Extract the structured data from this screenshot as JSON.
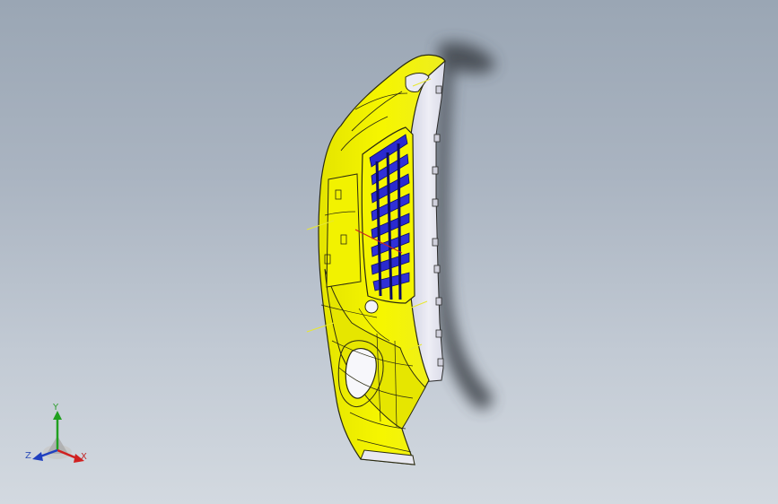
{
  "viewport": {
    "background_top": "#9aa6b4",
    "background_bottom": "#d3d9e0"
  },
  "model": {
    "part": "bumper-cover",
    "body_color": "#f0f000",
    "edge_color": "#2a2a10",
    "grille_color": "#2a2ad0",
    "side_color": "#e6e6f0",
    "shadow_color": "#3e4248",
    "sketch_line_color": "#e8e830",
    "direction_line_color": "#d02020"
  },
  "triad": {
    "icon": "coordinate-triad-icon",
    "y_label": "Y",
    "z_label": "Z",
    "x_label": "X",
    "x_color": "#d02020",
    "y_color": "#20a020",
    "z_color": "#2040c0"
  }
}
